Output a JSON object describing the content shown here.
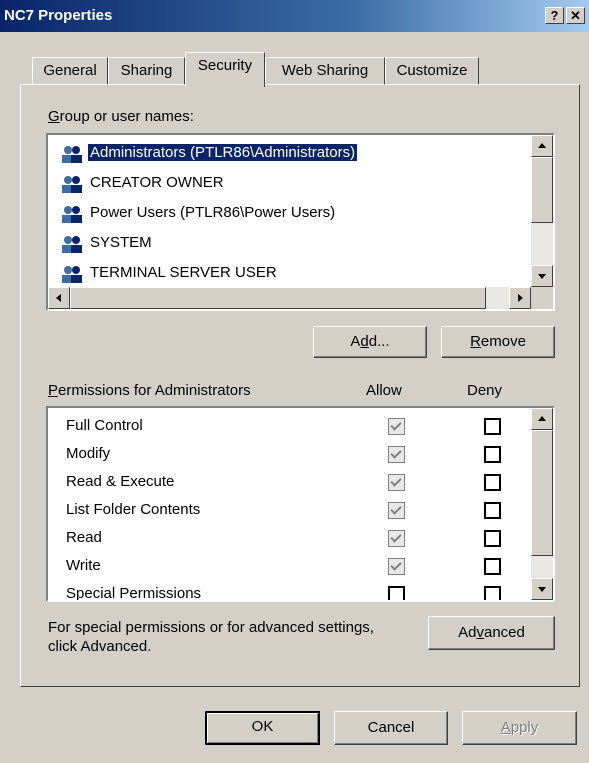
{
  "window": {
    "title": "NC7 Properties",
    "help_btn": "?",
    "close_btn": "✕"
  },
  "tabs": [
    {
      "label": "General"
    },
    {
      "label": "Sharing"
    },
    {
      "label": "Security"
    },
    {
      "label": "Web Sharing"
    },
    {
      "label": "Customize"
    }
  ],
  "group_label": {
    "accel": "G",
    "rest": "roup or user names:"
  },
  "users": [
    {
      "name": "Administrators (PTLR86\\Administrators)"
    },
    {
      "name": "CREATOR OWNER"
    },
    {
      "name": "Power Users (PTLR86\\Power Users)"
    },
    {
      "name": "SYSTEM"
    },
    {
      "name": "TERMINAL SERVER USER"
    }
  ],
  "buttons": {
    "add": {
      "pre": "A",
      "accel": "d",
      "post": "d..."
    },
    "remove": {
      "accel": "R",
      "post": "emove"
    },
    "advanced": {
      "pre": "Ad",
      "accel": "v",
      "post": "anced"
    },
    "ok": "OK",
    "cancel": "Cancel",
    "apply": {
      "accel": "A",
      "post": "pply"
    }
  },
  "permissions_label": {
    "accel": "P",
    "rest": "ermissions for Administrators"
  },
  "col_allow": "Allow",
  "col_deny": "Deny",
  "permissions": [
    {
      "name": "Full Control",
      "allow": true,
      "deny": false
    },
    {
      "name": "Modify",
      "allow": true,
      "deny": false
    },
    {
      "name": "Read & Execute",
      "allow": true,
      "deny": false
    },
    {
      "name": "List Folder Contents",
      "allow": true,
      "deny": false
    },
    {
      "name": "Read",
      "allow": true,
      "deny": false
    },
    {
      "name": "Write",
      "allow": true,
      "deny": false
    },
    {
      "name": "Special Permissions",
      "allow": false,
      "deny": false
    }
  ],
  "advanced_text": {
    "line1": "For special permissions or for advanced settings,",
    "line2": "click Advanced."
  }
}
